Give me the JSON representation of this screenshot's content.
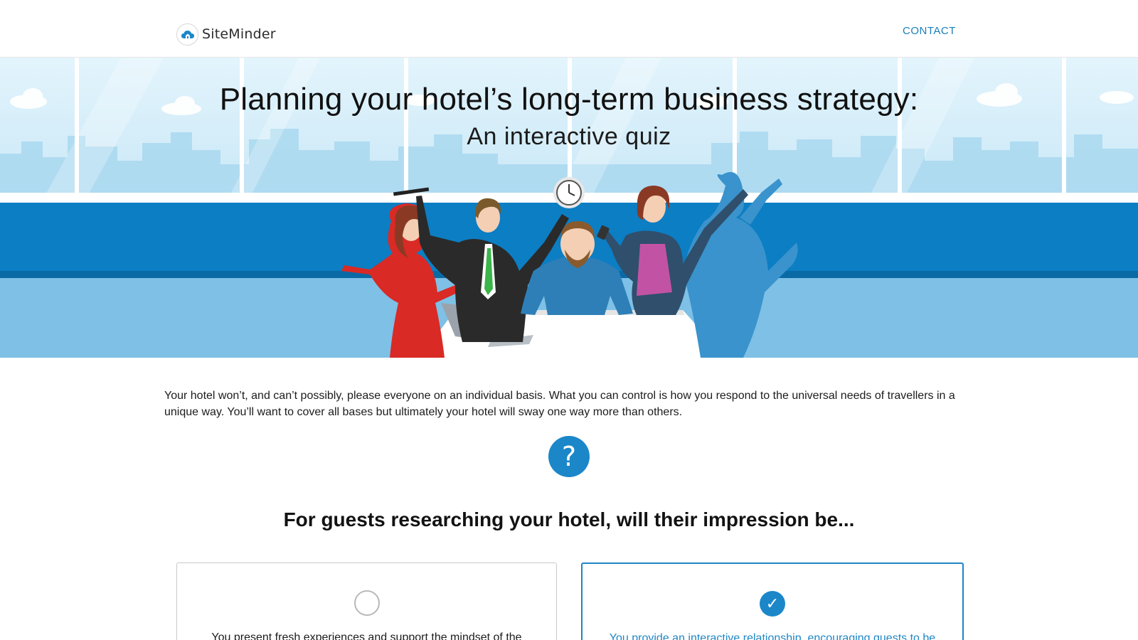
{
  "header": {
    "brand": "SiteMinder",
    "contact_label": "CONTACT"
  },
  "hero": {
    "title": "Planning your hotel’s long-term business strategy:",
    "subtitle": "An interactive quiz"
  },
  "intro": {
    "text": "Your hotel won’t, and can’t possibly, please everyone on an individual basis. What you can control is how you respond to the universal needs of travellers in a unique way. You’ll want to cover all bases but ultimately your hotel will sway one way more than others."
  },
  "quiz": {
    "question_icon": "?",
    "question": "For guests researching your hotel, will their impression be...",
    "options": [
      {
        "text": "You present fresh experiences and support the mindset of the",
        "selected": false
      },
      {
        "text": "You provide an interactive relationship, encouraging guests to be",
        "selected": true
      }
    ]
  },
  "colors": {
    "accent": "#1b87c9",
    "link": "#1a7fb9"
  },
  "icons": {
    "logo": "cloud-house-icon",
    "question": "question-icon",
    "checked": "checkmark-icon"
  }
}
